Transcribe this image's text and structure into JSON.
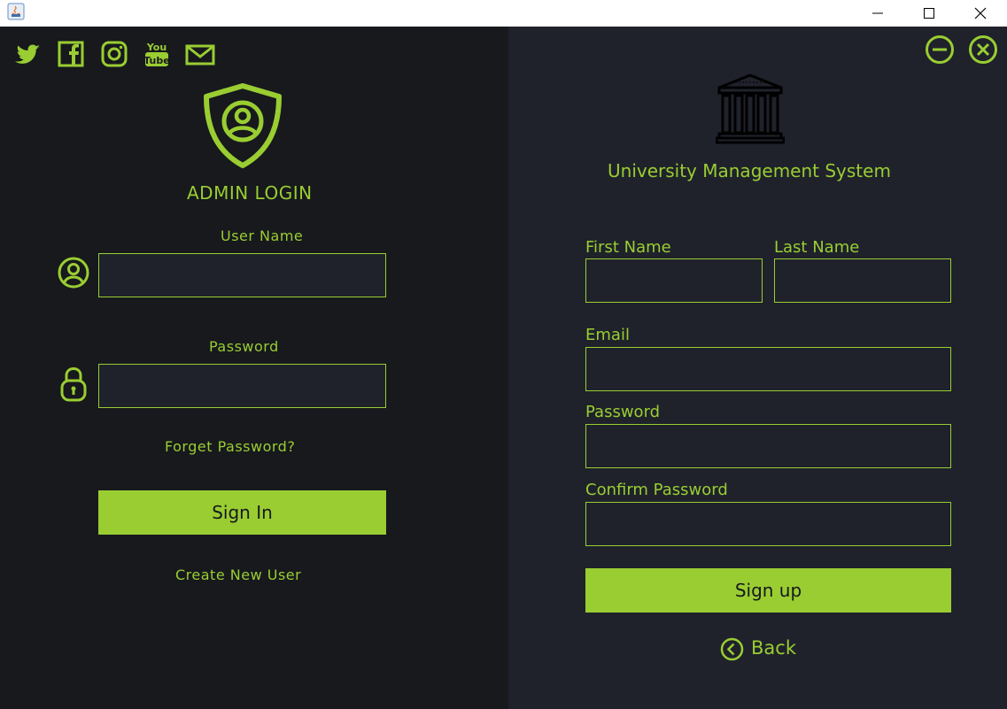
{
  "window": {
    "app_icon": "java-icon",
    "controls": [
      "minimize-icon",
      "maximize-icon",
      "close-icon"
    ]
  },
  "left": {
    "social_icons": [
      "twitter-icon",
      "facebook-icon",
      "instagram-icon",
      "youtube-icon",
      "mail-icon"
    ],
    "youtube_text_top": "You",
    "youtube_text_bottom": "Tube",
    "title": "ADMIN LOGIN",
    "username_label": "User Name",
    "username_value": "",
    "password_label": "Password",
    "password_value": "",
    "forget_password": "Forget Password?",
    "sign_in": "Sign In",
    "create_user": "Create New User"
  },
  "right": {
    "app_title": "University Management System",
    "first_name_label": "First Name",
    "last_name_label": "Last Name",
    "email_label": "Email",
    "password_label": "Password",
    "confirm_password_label": "Confirm Password",
    "first_name_value": "",
    "last_name_value": "",
    "email_value": "",
    "password_value": "",
    "confirm_password_value": "",
    "sign_up": "Sign up",
    "back": "Back"
  },
  "colors": {
    "accent": "#9acd32",
    "left_bg": "#17191d",
    "right_bg": "#1f222b"
  }
}
